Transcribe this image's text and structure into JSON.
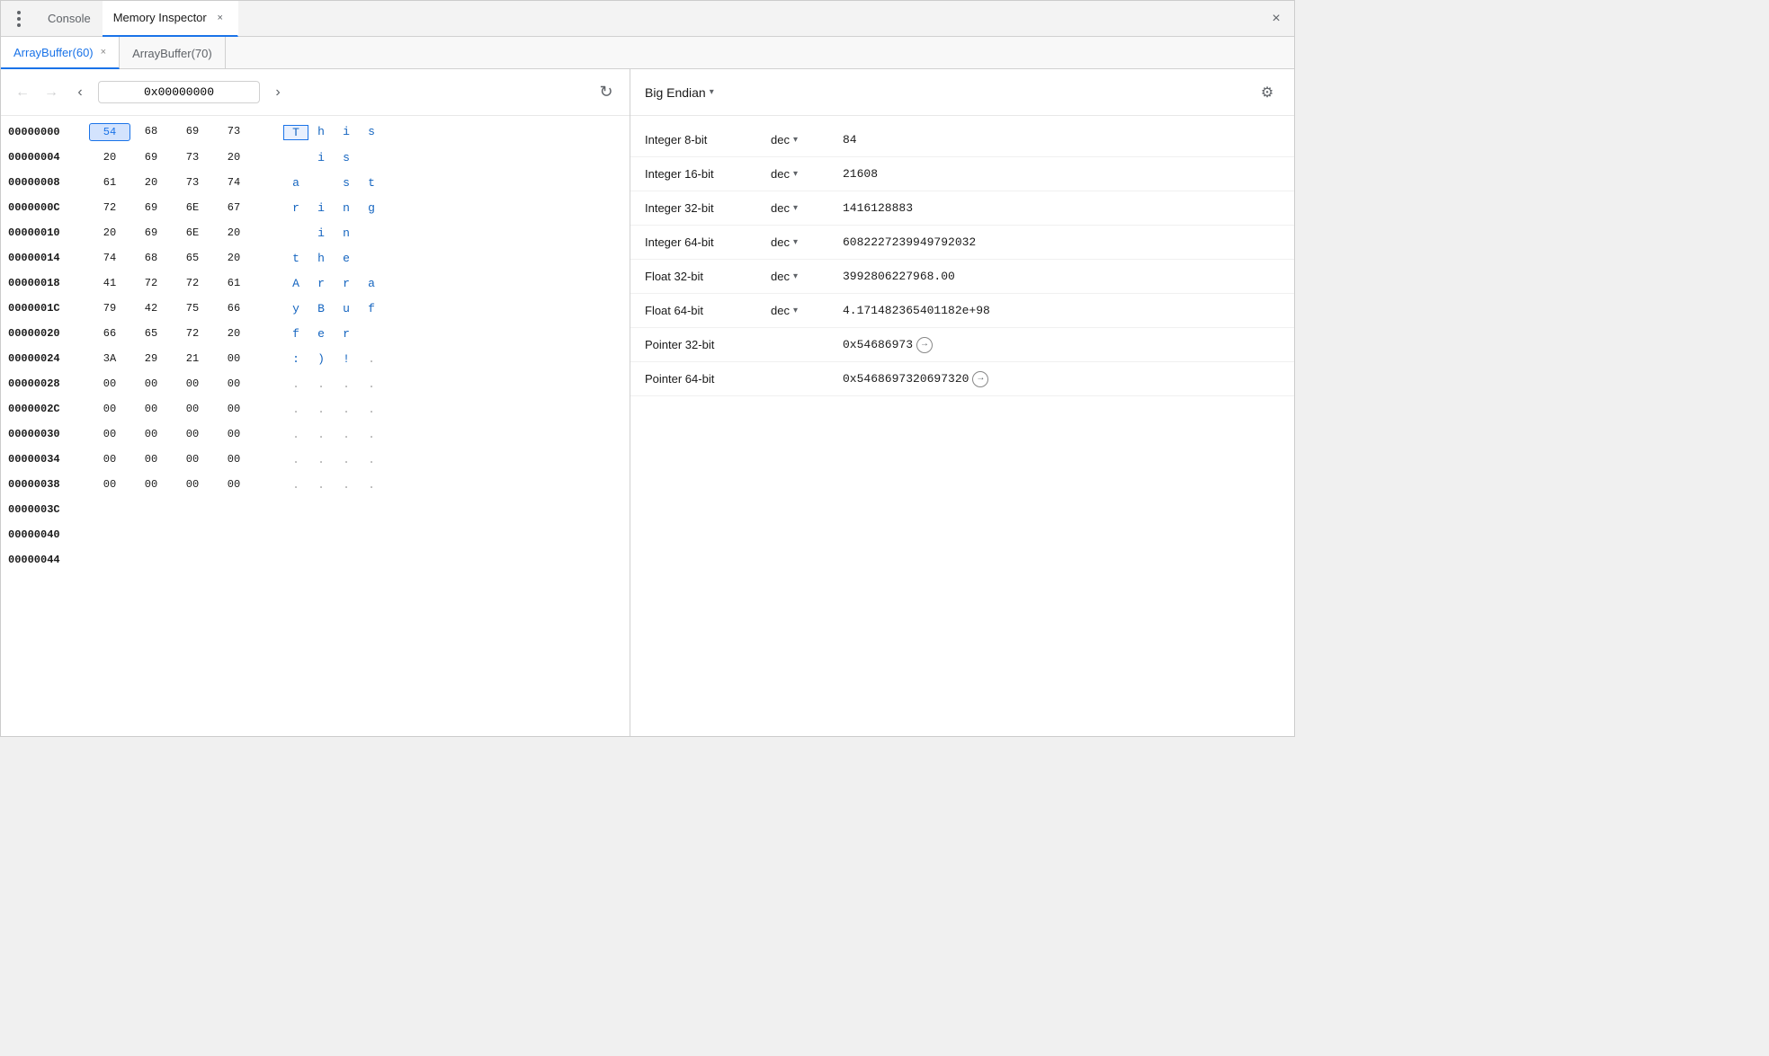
{
  "window": {
    "top_tabs": [
      {
        "id": "console",
        "label": "Console",
        "active": false,
        "closable": false
      },
      {
        "id": "memory-inspector",
        "label": "Memory Inspector",
        "active": true,
        "closable": true
      }
    ],
    "close_label": "×"
  },
  "buffer_tabs": [
    {
      "id": "ab60",
      "label": "ArrayBuffer(60)",
      "active": true,
      "closable": true
    },
    {
      "id": "ab70",
      "label": "ArrayBuffer(70)",
      "active": false,
      "closable": false
    }
  ],
  "left": {
    "nav": {
      "back_label": "‹",
      "forward_label": "›",
      "address": "0x00000000",
      "prev_label": "‹",
      "next_label": "›",
      "refresh_label": "↻"
    },
    "rows": [
      {
        "address": "00000000",
        "bytes": [
          "54",
          "68",
          "69",
          "73"
        ],
        "ascii": [
          "T",
          "h",
          "i",
          "s"
        ],
        "selected_byte": 0,
        "selected_ascii": 0
      },
      {
        "address": "00000004",
        "bytes": [
          "20",
          "69",
          "73",
          "20"
        ],
        "ascii": [
          " ",
          "i",
          "s",
          " "
        ],
        "selected_byte": -1,
        "selected_ascii": -1
      },
      {
        "address": "00000008",
        "bytes": [
          "61",
          "20",
          "73",
          "74"
        ],
        "ascii": [
          "a",
          " ",
          "s",
          "t"
        ],
        "selected_byte": -1,
        "selected_ascii": -1
      },
      {
        "address": "0000000C",
        "bytes": [
          "72",
          "69",
          "6E",
          "67"
        ],
        "ascii": [
          "r",
          "i",
          "n",
          "g"
        ],
        "selected_byte": -1,
        "selected_ascii": -1
      },
      {
        "address": "00000010",
        "bytes": [
          "20",
          "69",
          "6E",
          "20"
        ],
        "ascii": [
          " ",
          "i",
          "n",
          " "
        ],
        "selected_byte": -1,
        "selected_ascii": -1
      },
      {
        "address": "00000014",
        "bytes": [
          "74",
          "68",
          "65",
          "20"
        ],
        "ascii": [
          "t",
          "h",
          "e",
          " "
        ],
        "selected_byte": -1,
        "selected_ascii": -1
      },
      {
        "address": "00000018",
        "bytes": [
          "41",
          "72",
          "72",
          "61"
        ],
        "ascii": [
          "A",
          "r",
          "r",
          "a"
        ],
        "selected_byte": -1,
        "selected_ascii": -1
      },
      {
        "address": "0000001C",
        "bytes": [
          "79",
          "42",
          "75",
          "66"
        ],
        "ascii": [
          "y",
          "B",
          "u",
          "f"
        ],
        "selected_byte": -1,
        "selected_ascii": -1
      },
      {
        "address": "00000020",
        "bytes": [
          "66",
          "65",
          "72",
          "20"
        ],
        "ascii": [
          "f",
          "e",
          "r",
          " "
        ],
        "selected_byte": -1,
        "selected_ascii": -1
      },
      {
        "address": "00000024",
        "bytes": [
          "3A",
          "29",
          "21",
          "00"
        ],
        "ascii": [
          ":",
          ")",
          "!",
          "."
        ],
        "selected_byte": -1,
        "selected_ascii": -1
      },
      {
        "address": "00000028",
        "bytes": [
          "00",
          "00",
          "00",
          "00"
        ],
        "ascii": [
          ".",
          ".",
          ".",
          "."
        ],
        "selected_byte": -1,
        "selected_ascii": -1
      },
      {
        "address": "0000002C",
        "bytes": [
          "00",
          "00",
          "00",
          "00"
        ],
        "ascii": [
          ".",
          ".",
          ".",
          "."
        ],
        "selected_byte": -1,
        "selected_ascii": -1
      },
      {
        "address": "00000030",
        "bytes": [
          "00",
          "00",
          "00",
          "00"
        ],
        "ascii": [
          ".",
          ".",
          ".",
          "."
        ],
        "selected_byte": -1,
        "selected_ascii": -1
      },
      {
        "address": "00000034",
        "bytes": [
          "00",
          "00",
          "00",
          "00"
        ],
        "ascii": [
          ".",
          ".",
          ".",
          "."
        ],
        "selected_byte": -1,
        "selected_ascii": -1
      },
      {
        "address": "00000038",
        "bytes": [
          "00",
          "00",
          "00",
          "00"
        ],
        "ascii": [
          ".",
          ".",
          ".",
          "."
        ],
        "selected_byte": -1,
        "selected_ascii": -1
      },
      {
        "address": "0000003C",
        "bytes": [],
        "ascii": [],
        "selected_byte": -1,
        "selected_ascii": -1
      },
      {
        "address": "00000040",
        "bytes": [],
        "ascii": [],
        "selected_byte": -1,
        "selected_ascii": -1
      },
      {
        "address": "00000044",
        "bytes": [],
        "ascii": [],
        "selected_byte": -1,
        "selected_ascii": -1
      }
    ]
  },
  "right": {
    "header": {
      "endian_label": "Big Endian",
      "dropdown_arrow": "▾",
      "settings_icon": "⚙"
    },
    "values": [
      {
        "label": "Integer 8-bit",
        "format": "dec",
        "has_dropdown": true,
        "value": "84",
        "is_pointer": false
      },
      {
        "label": "Integer 16-bit",
        "format": "dec",
        "has_dropdown": true,
        "value": "21608",
        "is_pointer": false
      },
      {
        "label": "Integer 32-bit",
        "format": "dec",
        "has_dropdown": true,
        "value": "1416128883",
        "is_pointer": false
      },
      {
        "label": "Integer 64-bit",
        "format": "dec",
        "has_dropdown": true,
        "value": "6082227239949792032",
        "is_pointer": false
      },
      {
        "label": "Float 32-bit",
        "format": "dec",
        "has_dropdown": true,
        "value": "3992806227968.00",
        "is_pointer": false
      },
      {
        "label": "Float 64-bit",
        "format": "dec",
        "has_dropdown": true,
        "value": "4.171482365401182e+98",
        "is_pointer": false
      },
      {
        "label": "Pointer 32-bit",
        "format": "",
        "has_dropdown": false,
        "value": "0x54686973",
        "is_pointer": true
      },
      {
        "label": "Pointer 64-bit",
        "format": "",
        "has_dropdown": false,
        "value": "0x5468697320697320",
        "is_pointer": true
      }
    ],
    "pointer_arrow": "→"
  }
}
